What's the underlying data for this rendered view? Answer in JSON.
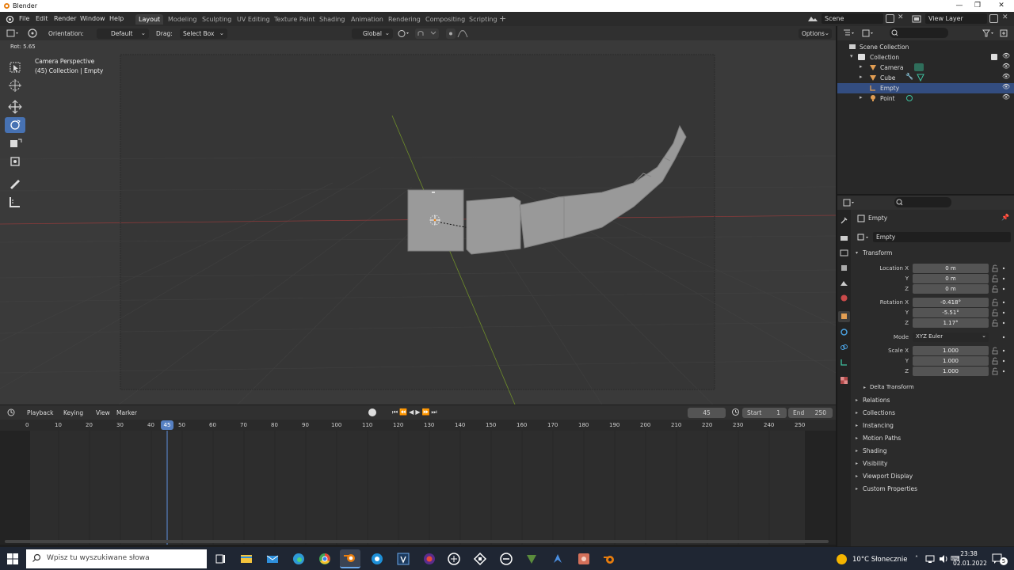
{
  "window": {
    "title": "Blender",
    "minimize": "—",
    "maximize": "❐",
    "close": "✕"
  },
  "menu": [
    "File",
    "Edit",
    "Render",
    "Window",
    "Help"
  ],
  "workspaces": [
    "Layout",
    "Modeling",
    "Sculpting",
    "UV Editing",
    "Texture Paint",
    "Shading",
    "Animation",
    "Rendering",
    "Compositing",
    "Scripting"
  ],
  "active_workspace": "Layout",
  "add_workspace": "+",
  "scene": "Scene",
  "view_layer": "View Layer",
  "header3d": {
    "orientation_label": "Orientation:",
    "orientation_value": "Default",
    "drag_label": "Drag:",
    "drag_value": "Select Box",
    "transform_orientation": "Global",
    "options": "Options"
  },
  "viewport": {
    "operator_status": "Rot: 5.65",
    "camera_label": "Camera Perspective",
    "collection_label": "(45) Collection | Empty"
  },
  "timeline": {
    "menus": [
      "Playback",
      "Keying",
      "View",
      "Marker"
    ],
    "current_frame": "45",
    "start_label": "Start",
    "start_value": "1",
    "end_label": "End",
    "end_value": "250",
    "ruler": [
      "0",
      "10",
      "20",
      "30",
      "40",
      "45",
      "50",
      "60",
      "70",
      "80",
      "90",
      "100",
      "110",
      "120",
      "130",
      "140",
      "150",
      "160",
      "170",
      "180",
      "190",
      "200",
      "210",
      "220",
      "230",
      "240",
      "250"
    ]
  },
  "outliner": {
    "scene_collection": "Scene Collection",
    "items": [
      {
        "name": "Collection",
        "level": 0
      },
      {
        "name": "Camera",
        "level": 1
      },
      {
        "name": "Cube",
        "level": 1
      },
      {
        "name": "Empty",
        "level": 1,
        "selected": true
      },
      {
        "name": "Point",
        "level": 1
      }
    ]
  },
  "properties": {
    "object_name": "Empty",
    "data_name": "Empty",
    "transform_title": "Transform",
    "location_x_label": "Location X",
    "location": [
      "0 m",
      "0 m",
      "0 m"
    ],
    "rotation_x_label": "Rotation X",
    "rotation": [
      "-0.418°",
      "-5.51°",
      "1.17°"
    ],
    "mode_label": "Mode",
    "mode_value": "XYZ Euler",
    "scale_x_label": "Scale X",
    "scale": [
      "1.000",
      "1.000",
      "1.000"
    ],
    "y_label": "Y",
    "z_label": "Z",
    "delta_transform": "Delta Transform",
    "panels": [
      "Relations",
      "Collections",
      "Instancing",
      "Motion Paths",
      "Shading",
      "Visibility",
      "Viewport Display",
      "Custom Properties"
    ]
  },
  "taskbar": {
    "search_placeholder": "Wpisz tu wyszukiwane słowa",
    "weather": "10°C Słonecznie",
    "time": "23:38",
    "date": "02.01.2022",
    "notifications": "5"
  },
  "colors": {
    "accent": "#4772b3",
    "x_axis": "#8a3a3a",
    "y_axis": "#6f8e2a",
    "playhead": "#5680c2"
  }
}
